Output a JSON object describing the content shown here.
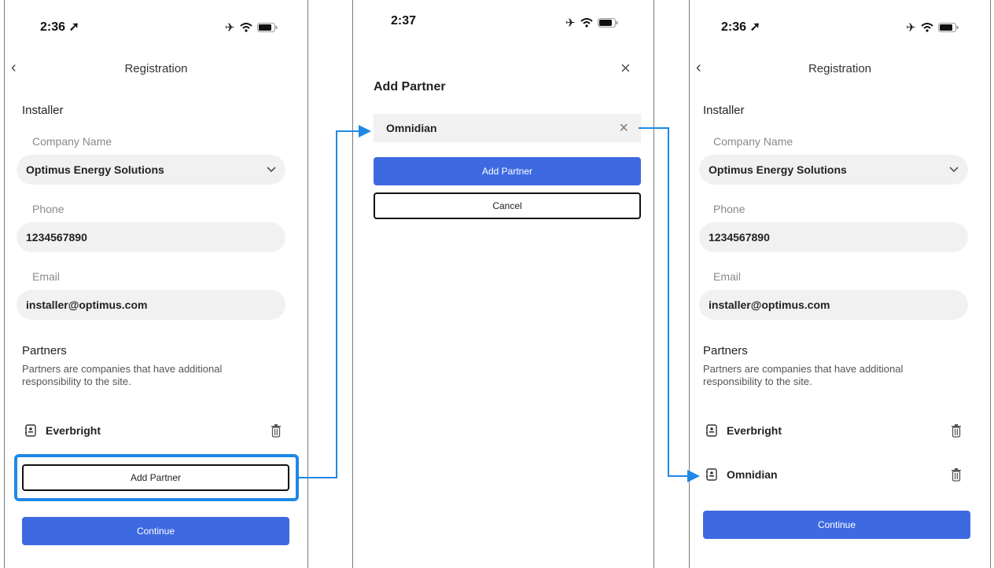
{
  "colors": {
    "accent": "#3e6ae1",
    "connector": "#1e88e5",
    "field_bg": "#f1f1f1"
  },
  "screen1": {
    "status_time": "2:36",
    "nav_title": "Registration",
    "installer_section": "Installer",
    "company_label": "Company Name",
    "company_value": "Optimus Energy Solutions",
    "phone_label": "Phone",
    "phone_value": "1234567890",
    "email_label": "Email",
    "email_value": "installer@optimus.com",
    "partners_title": "Partners",
    "partners_desc_line1": "Partners are companies that have additional",
    "partners_desc_line2": "responsibility to the site.",
    "partners": [
      "Everbright"
    ],
    "add_partner_label": "Add Partner",
    "continue_label": "Continue"
  },
  "screen2": {
    "status_time": "2:37",
    "title": "Add Partner",
    "search_value": "Omnidian",
    "add_partner_label": "Add Partner",
    "cancel_label": "Cancel"
  },
  "screen3": {
    "status_time": "2:36",
    "nav_title": "Registration",
    "installer_section": "Installer",
    "company_label": "Company Name",
    "company_value": "Optimus Energy Solutions",
    "phone_label": "Phone",
    "phone_value": "1234567890",
    "email_label": "Email",
    "email_value": "installer@optimus.com",
    "partners_title": "Partners",
    "partners_desc_line1": "Partners are companies that have additional",
    "partners_desc_line2": "responsibility to the site.",
    "partners": [
      "Everbright",
      "Omnidian"
    ],
    "continue_label": "Continue"
  }
}
